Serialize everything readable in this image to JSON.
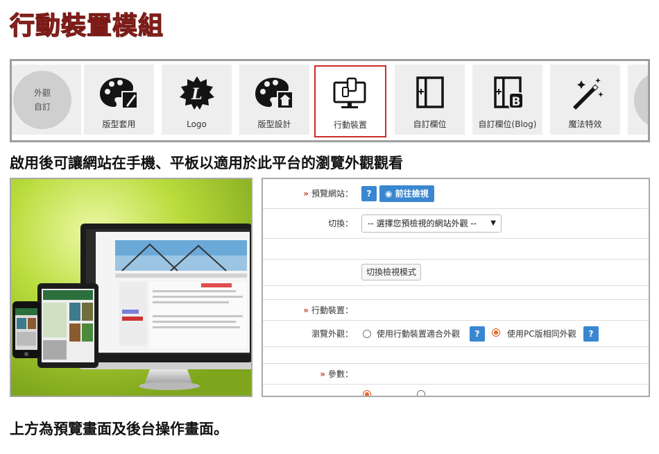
{
  "page_title": "行動裝置模組",
  "module_bar": {
    "left_card_label": "外觀\n自訂",
    "modules": [
      {
        "label": "版型套用",
        "icon": "palette-brush-icon"
      },
      {
        "label": "Logo",
        "icon": "logo-badge-icon"
      },
      {
        "label": "版型設計",
        "icon": "palette-home-icon"
      },
      {
        "label": "行動裝置",
        "icon": "devices-icon",
        "active": true
      },
      {
        "label": "自訂欄位",
        "icon": "custom-column-icon"
      },
      {
        "label": "自訂欄位(Blog)",
        "icon": "custom-column-blog-icon"
      },
      {
        "label": "魔法特效",
        "icon": "magic-wand-icon"
      }
    ],
    "active_border_color": "#cc2a2a"
  },
  "section_heading": "啟用後可讓網站在手機、平板以適用於此平台的瀏覽外觀觀看",
  "settings": {
    "preview_label": "預覽網站：",
    "help_text": "?",
    "goto_preview_label": "前往檢視",
    "switch_label": "切換：",
    "select_value": "-- 選擇您預檢視的網站外觀 --",
    "switch_mode_button": "切換檢視模式",
    "mobile_section_label": "行動裝置：",
    "browse_label": "瀏覽外觀：",
    "option_mobile": "使用行動裝置適合外觀",
    "option_pc": "使用PC版相同外觀",
    "params_label": "參數："
  },
  "footer_note": "上方為預覽畫面及後台操作畫面。",
  "colors": {
    "title_red": "#d83a32",
    "help_blue": "#3a87d1",
    "radio_orange": "#e8641e"
  }
}
